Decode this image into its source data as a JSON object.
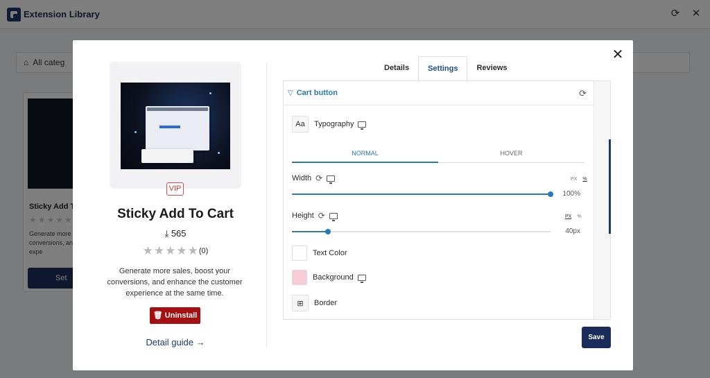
{
  "app": {
    "title": "Extension Library",
    "filter_label": "All categ"
  },
  "background_card": {
    "name": "Sticky Add T",
    "stars": "★★★★★",
    "desc": "Generate more conversions, an customer expe",
    "settings_label": "Set"
  },
  "detail": {
    "badge": "VIP",
    "name": "Sticky Add To Cart",
    "downloads": "565",
    "rating_stars": "★★★★★",
    "rating_count": "(0)",
    "description": "Generate more sales, boost your conversions, and enhance the customer experience at the same time.",
    "uninstall_label": "Uninstall",
    "detail_guide_label": "Detail guide →"
  },
  "tabs": [
    {
      "label": "Details"
    },
    {
      "label": "Settings",
      "active": true
    },
    {
      "label": "Reviews"
    }
  ],
  "settings": {
    "section_title": "Cart button",
    "typography_label": "Typography",
    "typography_icon_text": "Aa",
    "state_tabs": [
      "NORMAL",
      "HOVER"
    ],
    "width": {
      "label": "Width",
      "value": "100%",
      "percent": 100,
      "units": [
        "PX",
        "%"
      ],
      "selected_unit": "%"
    },
    "height": {
      "label": "Height",
      "value": "40px",
      "percent": 14,
      "units": [
        "PX",
        "%"
      ],
      "selected_unit": "PX"
    },
    "text_color": {
      "label": "Text Color",
      "color": "#ffffff"
    },
    "background": {
      "label": "Background",
      "color": "#f7ccd7"
    },
    "border_label": "Border"
  },
  "save_label": "Save",
  "colors": {
    "accent": "#2a7ab8",
    "navy": "#1a2d5a",
    "danger": "#a50f0f"
  }
}
